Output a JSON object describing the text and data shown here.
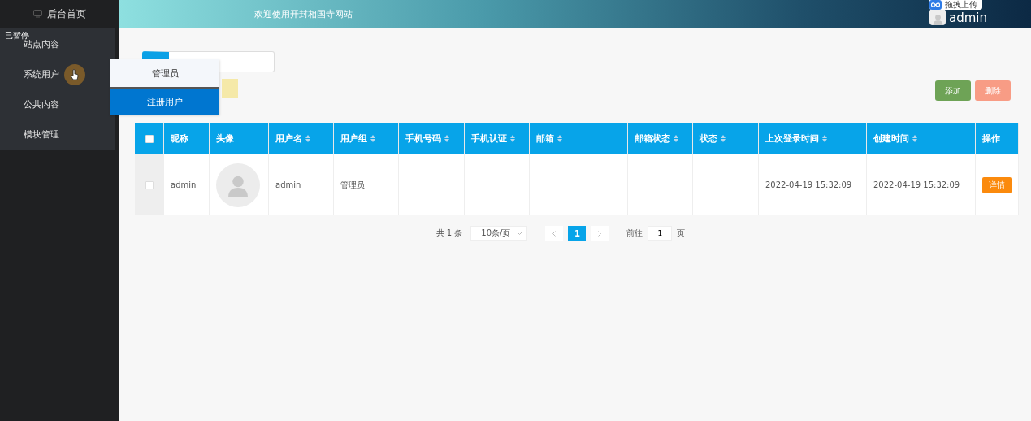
{
  "sidebar": {
    "home": "后台首页",
    "overlay_label": "已暂停",
    "items": [
      {
        "label": "站点内容",
        "hovered": false
      },
      {
        "label": "系统用户",
        "hovered": true
      },
      {
        "label": "公共内容",
        "hovered": false
      },
      {
        "label": "模块管理",
        "hovered": false
      }
    ]
  },
  "submenu": {
    "items": [
      {
        "label": "管理员",
        "selected": false
      },
      {
        "label": "注册用户",
        "selected": true
      }
    ]
  },
  "header": {
    "title": "欢迎使用开封相国寺网站",
    "user": "admin",
    "upload_badge": "拖拽上传"
  },
  "toolbar": {
    "buttons": [
      {
        "label": "添加",
        "kind": "add"
      },
      {
        "label": "删除",
        "kind": "delete"
      }
    ]
  },
  "table": {
    "select_all": false,
    "columns": [
      {
        "label": "昵称",
        "sortable": false
      },
      {
        "label": "头像",
        "sortable": false
      },
      {
        "label": "用户名",
        "sortable": true
      },
      {
        "label": "用户组",
        "sortable": true
      },
      {
        "label": "手机号码",
        "sortable": true
      },
      {
        "label": "手机认证",
        "sortable": true
      },
      {
        "label": "邮箱",
        "sortable": true
      },
      {
        "label": "邮箱状态",
        "sortable": true
      },
      {
        "label": "状态",
        "sortable": true
      },
      {
        "label": "上次登录时间",
        "sortable": true
      },
      {
        "label": "创建时间",
        "sortable": true
      },
      {
        "label": "操作",
        "sortable": false
      }
    ],
    "rows": [
      {
        "checked": false,
        "cells": [
          {
            "kind": "text",
            "text": "admin"
          },
          {
            "kind": "avatar"
          },
          {
            "kind": "text",
            "text": "admin"
          },
          {
            "kind": "text",
            "text": "管理员"
          },
          {
            "kind": "empty"
          },
          {
            "kind": "empty"
          },
          {
            "kind": "empty"
          },
          {
            "kind": "empty"
          },
          {
            "kind": "empty"
          },
          {
            "kind": "text",
            "text": "2022-04-19 15:32:09"
          },
          {
            "kind": "text",
            "text": "2022-04-19 15:32:09"
          },
          {
            "kind": "action",
            "text": "详情"
          }
        ]
      }
    ]
  },
  "pagination": {
    "total": "共 1 条",
    "page_size": "10条/页",
    "pages": [
      {
        "label": "1",
        "selected": true
      }
    ],
    "goto_label": "前往",
    "goto_value": "1",
    "page_suffix": "页"
  }
}
